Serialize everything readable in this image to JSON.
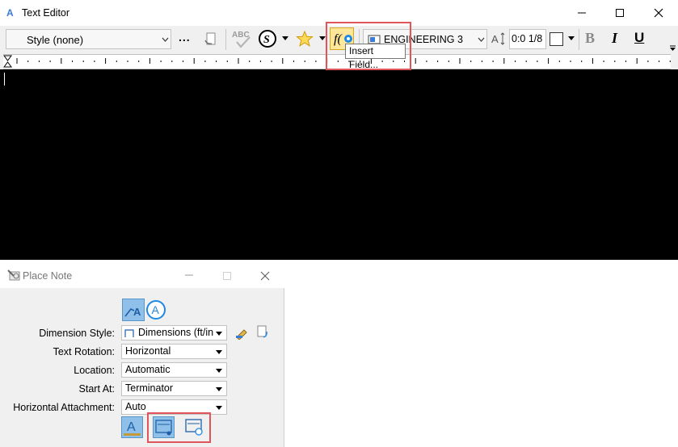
{
  "text_editor": {
    "title": "Text Editor",
    "style_combo": "Style (none)",
    "more_label": "...",
    "font_combo": "ENGINEERING 3",
    "size_value": "0:0 1/8",
    "bold_label": "B",
    "italic_label": "I",
    "underline_label": "U",
    "tooltip": "Insert Field..."
  },
  "place_note": {
    "title": "Place Note",
    "fields": [
      {
        "label": "Dimension Style:",
        "value": "Dimensions (ft/in"
      },
      {
        "label": "Text Rotation:",
        "value": "Horizontal"
      },
      {
        "label": "Location:",
        "value": "Automatic"
      },
      {
        "label": "Start At:",
        "value": "Terminator"
      },
      {
        "label": "Horizontal Attachment:",
        "value": "Auto"
      }
    ]
  },
  "colors": {
    "highlight_red": "#e0555a",
    "accent_blue": "#1e88e5",
    "editor_bg": "#000000"
  }
}
